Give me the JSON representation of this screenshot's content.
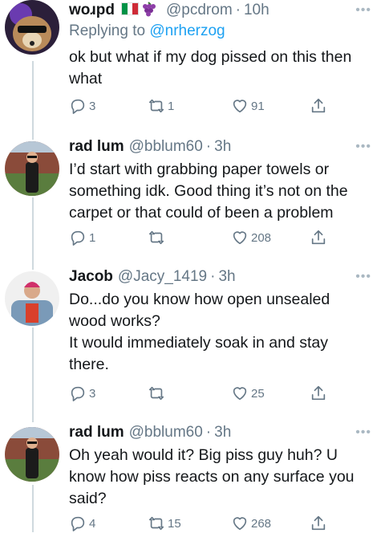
{
  "tweets": [
    {
      "display_name": "woɹpd",
      "handle": "@pcdrom",
      "time": "10h",
      "reply_to_label": "Replying to",
      "reply_to_user": "@nrherzog",
      "lines": [
        "ok but what if my dog pissed on this then",
        "what"
      ],
      "replies": "3",
      "retweets": "1",
      "likes": "91"
    },
    {
      "display_name": "rad lum",
      "handle": "@bblum60",
      "time": "3h",
      "lines": [
        "I’d start with grabbing paper towels or",
        "something idk. Good thing it’s not on the",
        "carpet or that could of been a problem"
      ],
      "replies": "1",
      "retweets": "",
      "likes": "208"
    },
    {
      "display_name": "Jacob",
      "handle": "@Jacy_1419",
      "time": "3h",
      "lines": [
        "Do...do you know how open unsealed",
        "wood works?",
        "It would immediately soak in and stay",
        "there."
      ],
      "replies": "3",
      "retweets": "",
      "likes": "25"
    },
    {
      "display_name": "rad lum",
      "handle": "@bblum60",
      "time": "3h",
      "lines": [
        "Oh yeah would it? Big piss guy huh? U",
        "know how piss reacts on any surface you",
        "said?"
      ],
      "replies": "4",
      "retweets": "15",
      "likes": "268"
    }
  ],
  "separator": "·",
  "more_glyph": "•••",
  "colors": {
    "link": "#1da1f2",
    "muted": "#657786",
    "thread_line": "#cfd9de"
  },
  "icons": [
    "reply-icon",
    "retweet-icon",
    "heart-icon",
    "share-icon",
    "italy-flag-icon",
    "grapes-icon",
    "more-icon"
  ]
}
